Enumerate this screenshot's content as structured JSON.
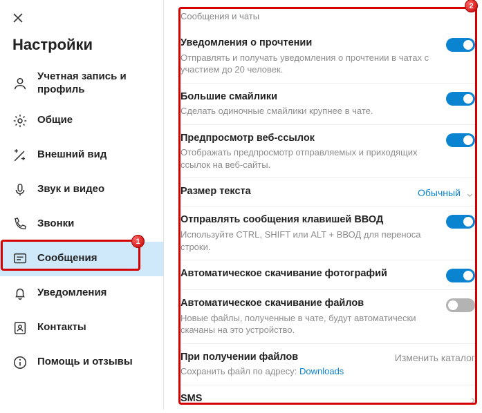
{
  "sidebar": {
    "title": "Настройки",
    "items": [
      {
        "label": "Учетная запись и профиль"
      },
      {
        "label": "Общие"
      },
      {
        "label": "Внешний вид"
      },
      {
        "label": "Звук и видео"
      },
      {
        "label": "Звонки"
      },
      {
        "label": "Сообщения"
      },
      {
        "label": "Уведомления"
      },
      {
        "label": "Контакты"
      },
      {
        "label": "Помощь и отзывы"
      }
    ]
  },
  "main": {
    "section": "Сообщения и чаты",
    "rows": {
      "read": {
        "title": "Уведомления о прочтении",
        "desc": "Отправлять и получать уведомления о прочтении в чатах с участием до 20 человек.",
        "on": true
      },
      "emoji": {
        "title": "Большие смайлики",
        "desc": "Сделать одиночные смайлики крупнее в чате.",
        "on": true
      },
      "links": {
        "title": "Предпросмотр веб-ссылок",
        "desc": "Отображать предпросмотр отправляемых и приходящих ссылок на веб-сайты.",
        "on": true
      },
      "textsize": {
        "title": "Размер текста",
        "value": "Обычный"
      },
      "enter": {
        "title": "Отправлять сообщения клавишей ВВОД",
        "desc": "Используйте CTRL, SHIFT или ALT + ВВОД для переноса строки.",
        "on": true
      },
      "photos": {
        "title": "Автоматическое скачивание фотографий",
        "on": true
      },
      "files": {
        "title": "Автоматическое скачивание файлов",
        "desc": "Новые файлы, полученные в чате, будут автоматически скачаны на это устройство.",
        "on": false
      },
      "recv": {
        "title": "При получении файлов",
        "desc_pre": "Сохранить файл по адресу: ",
        "desc_link": "Downloads",
        "action": "Изменить каталог"
      },
      "sms": {
        "title": "SMS"
      }
    }
  },
  "annotation": {
    "badge1": "1",
    "badge2": "2"
  }
}
